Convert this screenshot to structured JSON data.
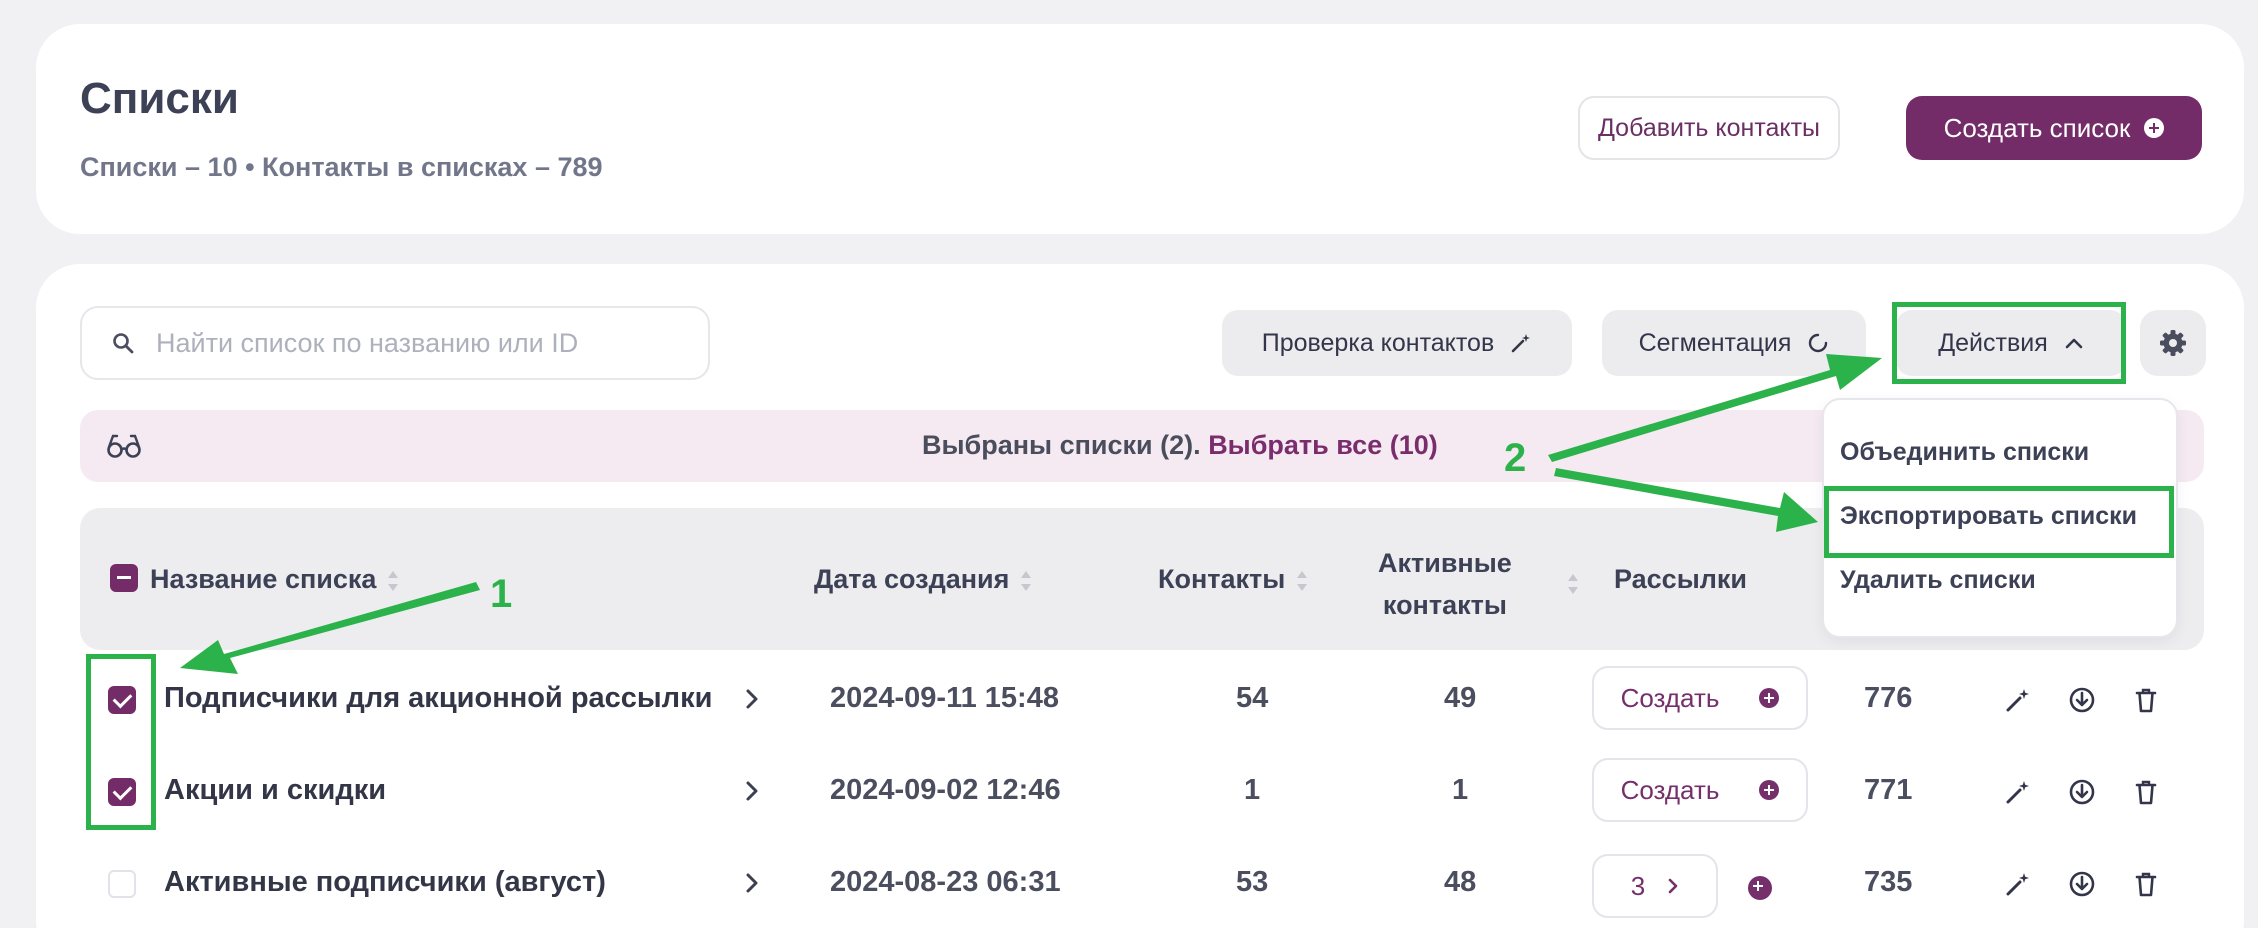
{
  "header": {
    "title": "Списки",
    "subtitle": "Списки – 10 • Контакты в списках – 789",
    "add_contacts": "Добавить контакты",
    "create_list": "Создать список"
  },
  "toolbar": {
    "search_placeholder": "Найти список по названию или ID",
    "check_contacts": "Проверка контактов",
    "segmentation": "Сегментация",
    "actions": "Действия"
  },
  "selection": {
    "text": "Выбраны списки (2).",
    "select_all": "Выбрать все (10)"
  },
  "table": {
    "columns": {
      "name": "Название списка",
      "date": "Дата создания",
      "contacts": "Контакты",
      "active_line1": "Активные",
      "active_line2": "контакты",
      "mailings": "Рассылки"
    },
    "rows": [
      {
        "name": "Подписчики для акционной рассылки",
        "date": "2024-09-11 15:48",
        "contacts": "54",
        "active": "49",
        "mailing_label": "Создать",
        "id": "776",
        "checked": true
      },
      {
        "name": "Акции и скидки",
        "date": "2024-09-02 12:46",
        "contacts": "1",
        "active": "1",
        "mailing_label": "Создать",
        "id": "771",
        "checked": true
      },
      {
        "name": "Активные подписчики (август)",
        "date": "2024-08-23 06:31",
        "contacts": "53",
        "active": "48",
        "mailing_label": "3",
        "id": "735",
        "checked": false
      }
    ]
  },
  "dropdown": {
    "items": [
      "Объединить списки",
      "Экспортировать списки",
      "Удалить списки"
    ]
  },
  "annotations": {
    "step1": "1",
    "step2": "2",
    "highlight_color": "#2cb24a"
  },
  "colors": {
    "brand": "#732c67",
    "background": "#f1f1f4",
    "selection_bg": "#f5eaf1"
  }
}
